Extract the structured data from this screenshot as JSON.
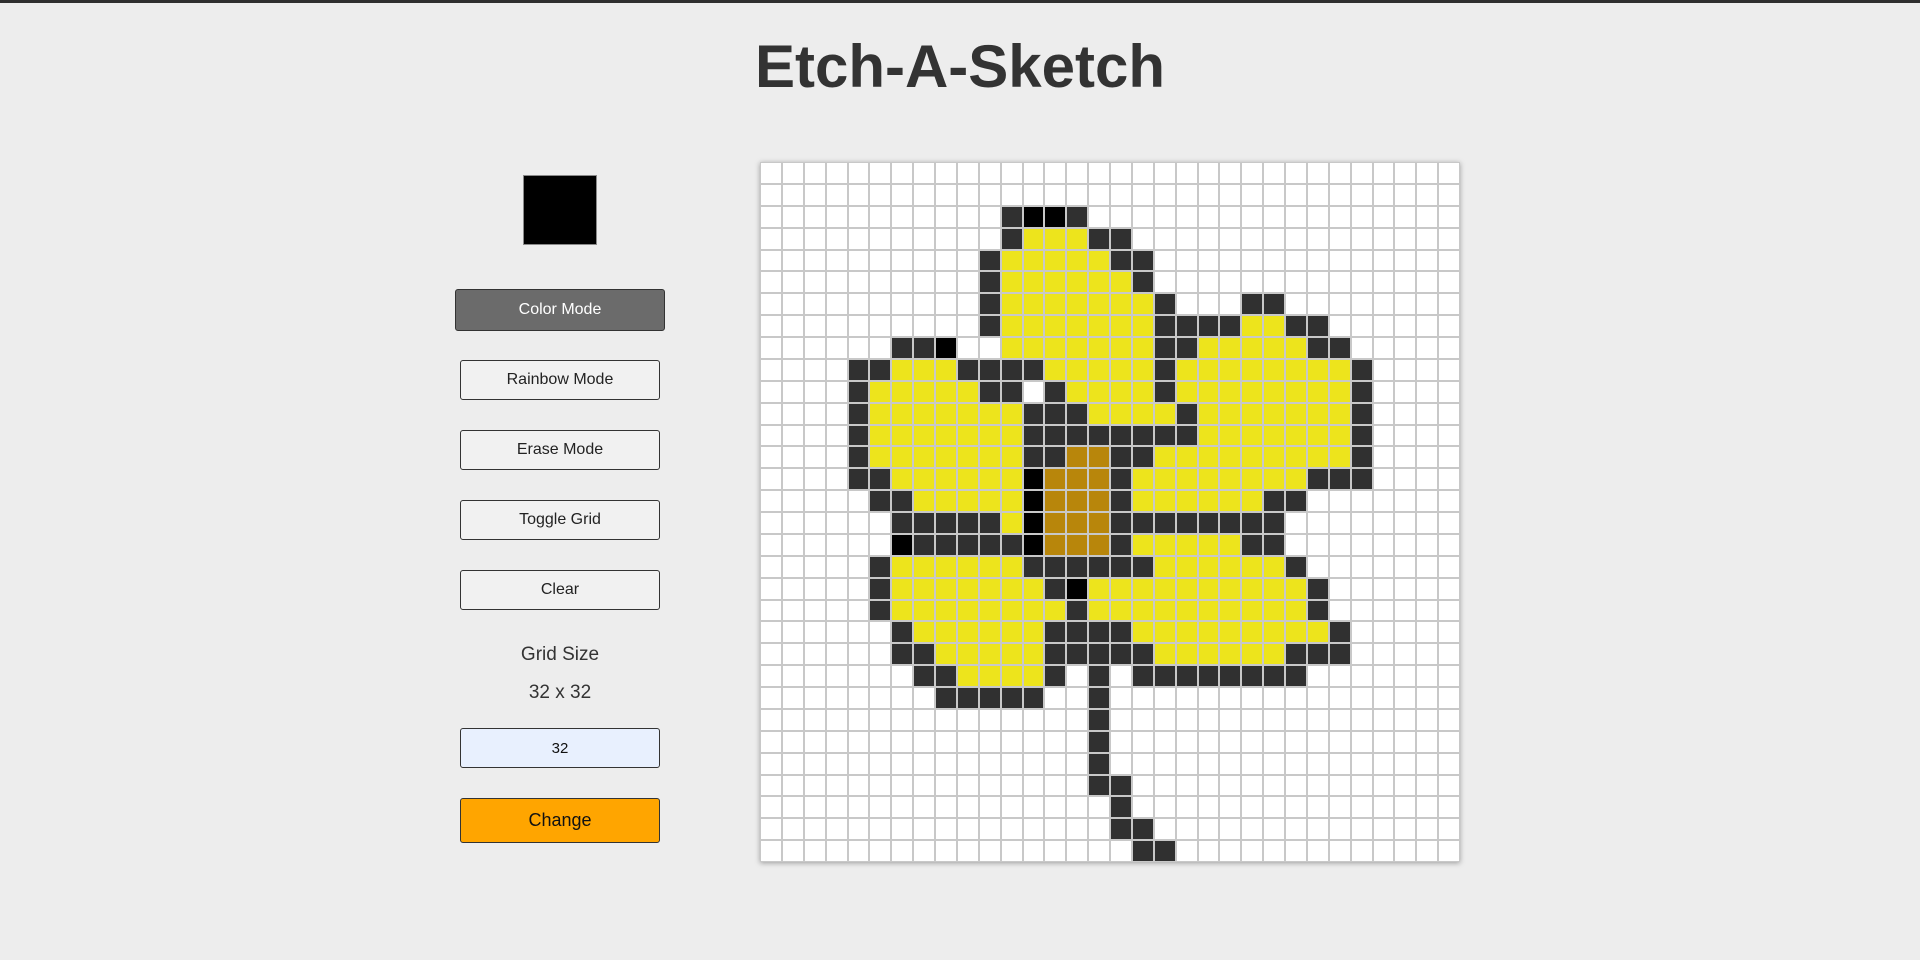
{
  "app": {
    "title": "Etch-A-Sketch"
  },
  "controls": {
    "current_color": "#000000",
    "buttons": {
      "color_mode": "Color Mode",
      "rainbow_mode": "Rainbow Mode",
      "erase_mode": "Erase Mode",
      "toggle_grid": "Toggle Grid",
      "clear": "Clear"
    },
    "active_mode": "color_mode",
    "grid_size_label": "Grid Size",
    "grid_size_display": "32 x 32",
    "grid_size_input": "32",
    "change_label": "Change"
  },
  "grid": {
    "size": 32,
    "palette": {
      ".": "#ffffff",
      "D": "#303030",
      "K": "#000000",
      "Y": "#ede41c",
      "B": "#b8860b"
    },
    "rows": [
      "................................",
      "................................",
      "...........DKKD.................",
      "...........DYYYDD...............",
      "..........DYYYYYDD..............",
      "..........DYYYYYYD..............",
      "..........DYYYYYYYD...DD........",
      "..........DYYYYYYYDDDDYYDD......",
      "......DDK..YYYYYYYDDYYYYYDD.....",
      "....DDYYYDDDDYYYYYDYYYYYYYYD....",
      "....DYYYYYDD.DYYYYDYYYYYYYYD....",
      "....DYYYYYYYDDDYYYYDYYYYYYYD....",
      "....DYYYYYYYDDDDDDDDYYYYYYYD....",
      "....DYYYYYYYDDBBDDYYYYYYYYYD....",
      "....DDYYYYYYKBBBDYYYYYYYYDDD....",
      ".....DDYYYYYKBBBDYYYYYYDD.......",
      "......DDDDDYKBBBDDDDDDDD........",
      "......KDDDDDKBBBDYYYYYDD........",
      ".....DYYYYYYDDDDDDYYYYYYD.......",
      ".....DYYYYYYYDKYYYYYYYYYYD......",
      ".....DYYYYYYYYDYYYYYYYYYYD......",
      "......DYYYYYYDDDDYYYYYYYYYD.....",
      "......DDYYYYYDDDDDYYYYYYDDD.....",
      ".......DDYYYYD.D.DDDDDDDD.......",
      "........DDDDD..D................",
      "...............D................",
      "...............D................",
      "...............D................",
      "...............DD...............",
      "................D...............",
      "................DD..............",
      ".................DD............."
    ]
  }
}
